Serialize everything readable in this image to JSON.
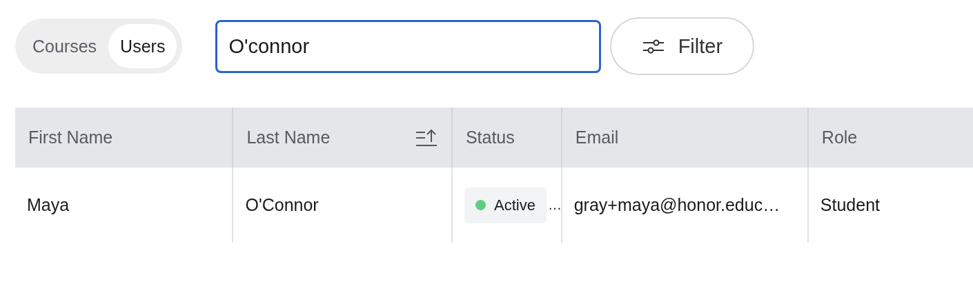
{
  "tabs": [
    {
      "label": "Courses",
      "selected": false
    },
    {
      "label": "Users",
      "selected": true
    }
  ],
  "search": {
    "value": "O'connor"
  },
  "filter_button": {
    "label": "Filter"
  },
  "table": {
    "columns": [
      {
        "label": "First Name",
        "sorted": false
      },
      {
        "label": "Last Name",
        "sorted": true
      },
      {
        "label": "Status",
        "sorted": false
      },
      {
        "label": "Email",
        "sorted": false
      },
      {
        "label": "Role",
        "sorted": false
      }
    ],
    "rows": [
      {
        "first_name": "Maya",
        "last_name": "O'Connor",
        "status": {
          "label": "Active",
          "color": "#5ccf7f",
          "overflow": "…"
        },
        "email": "gray+maya@honor.educ…",
        "role": "Student"
      }
    ]
  }
}
